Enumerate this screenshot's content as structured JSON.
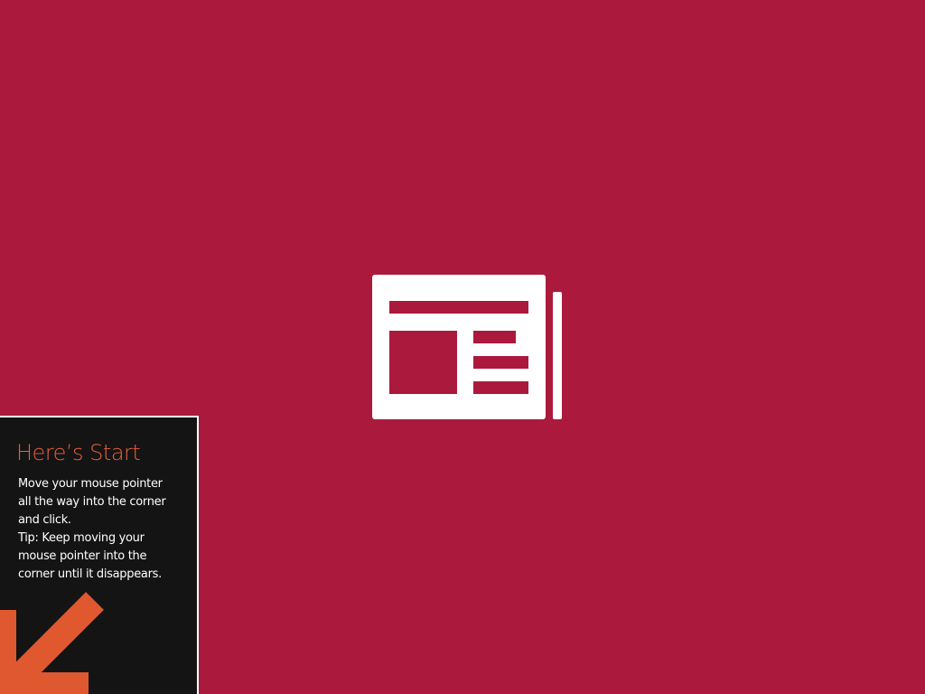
{
  "colors": {
    "splash_background": "#ab1a3c",
    "icon_foreground": "#ffffff",
    "tip_background": "#141414",
    "tip_title": "#e8613a",
    "tip_text": "#ffffff",
    "arrow": "#e0582f"
  },
  "splash": {
    "icon": "news-app-icon"
  },
  "tip": {
    "title": "Here’s Start",
    "body_lines": [
      "Move your mouse pointer",
      "all the way into the corner",
      "and click.",
      "Tip: Keep moving your",
      "mouse pointer into the",
      "corner until it disappears."
    ],
    "arrow_icon": "arrow-down-left-icon"
  }
}
